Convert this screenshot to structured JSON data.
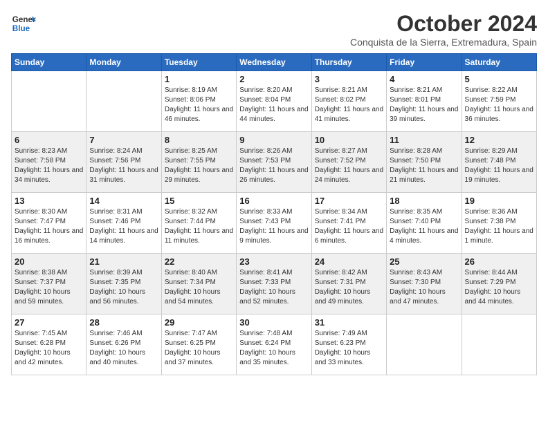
{
  "header": {
    "logo_general": "General",
    "logo_blue": "Blue",
    "month": "October 2024",
    "location": "Conquista de la Sierra, Extremadura, Spain"
  },
  "weekdays": [
    "Sunday",
    "Monday",
    "Tuesday",
    "Wednesday",
    "Thursday",
    "Friday",
    "Saturday"
  ],
  "weeks": [
    [
      {
        "day": "",
        "sunrise": "",
        "sunset": "",
        "daylight": ""
      },
      {
        "day": "",
        "sunrise": "",
        "sunset": "",
        "daylight": ""
      },
      {
        "day": "1",
        "sunrise": "Sunrise: 8:19 AM",
        "sunset": "Sunset: 8:06 PM",
        "daylight": "Daylight: 11 hours and 46 minutes."
      },
      {
        "day": "2",
        "sunrise": "Sunrise: 8:20 AM",
        "sunset": "Sunset: 8:04 PM",
        "daylight": "Daylight: 11 hours and 44 minutes."
      },
      {
        "day": "3",
        "sunrise": "Sunrise: 8:21 AM",
        "sunset": "Sunset: 8:02 PM",
        "daylight": "Daylight: 11 hours and 41 minutes."
      },
      {
        "day": "4",
        "sunrise": "Sunrise: 8:21 AM",
        "sunset": "Sunset: 8:01 PM",
        "daylight": "Daylight: 11 hours and 39 minutes."
      },
      {
        "day": "5",
        "sunrise": "Sunrise: 8:22 AM",
        "sunset": "Sunset: 7:59 PM",
        "daylight": "Daylight: 11 hours and 36 minutes."
      }
    ],
    [
      {
        "day": "6",
        "sunrise": "Sunrise: 8:23 AM",
        "sunset": "Sunset: 7:58 PM",
        "daylight": "Daylight: 11 hours and 34 minutes."
      },
      {
        "day": "7",
        "sunrise": "Sunrise: 8:24 AM",
        "sunset": "Sunset: 7:56 PM",
        "daylight": "Daylight: 11 hours and 31 minutes."
      },
      {
        "day": "8",
        "sunrise": "Sunrise: 8:25 AM",
        "sunset": "Sunset: 7:55 PM",
        "daylight": "Daylight: 11 hours and 29 minutes."
      },
      {
        "day": "9",
        "sunrise": "Sunrise: 8:26 AM",
        "sunset": "Sunset: 7:53 PM",
        "daylight": "Daylight: 11 hours and 26 minutes."
      },
      {
        "day": "10",
        "sunrise": "Sunrise: 8:27 AM",
        "sunset": "Sunset: 7:52 PM",
        "daylight": "Daylight: 11 hours and 24 minutes."
      },
      {
        "day": "11",
        "sunrise": "Sunrise: 8:28 AM",
        "sunset": "Sunset: 7:50 PM",
        "daylight": "Daylight: 11 hours and 21 minutes."
      },
      {
        "day": "12",
        "sunrise": "Sunrise: 8:29 AM",
        "sunset": "Sunset: 7:48 PM",
        "daylight": "Daylight: 11 hours and 19 minutes."
      }
    ],
    [
      {
        "day": "13",
        "sunrise": "Sunrise: 8:30 AM",
        "sunset": "Sunset: 7:47 PM",
        "daylight": "Daylight: 11 hours and 16 minutes."
      },
      {
        "day": "14",
        "sunrise": "Sunrise: 8:31 AM",
        "sunset": "Sunset: 7:46 PM",
        "daylight": "Daylight: 11 hours and 14 minutes."
      },
      {
        "day": "15",
        "sunrise": "Sunrise: 8:32 AM",
        "sunset": "Sunset: 7:44 PM",
        "daylight": "Daylight: 11 hours and 11 minutes."
      },
      {
        "day": "16",
        "sunrise": "Sunrise: 8:33 AM",
        "sunset": "Sunset: 7:43 PM",
        "daylight": "Daylight: 11 hours and 9 minutes."
      },
      {
        "day": "17",
        "sunrise": "Sunrise: 8:34 AM",
        "sunset": "Sunset: 7:41 PM",
        "daylight": "Daylight: 11 hours and 6 minutes."
      },
      {
        "day": "18",
        "sunrise": "Sunrise: 8:35 AM",
        "sunset": "Sunset: 7:40 PM",
        "daylight": "Daylight: 11 hours and 4 minutes."
      },
      {
        "day": "19",
        "sunrise": "Sunrise: 8:36 AM",
        "sunset": "Sunset: 7:38 PM",
        "daylight": "Daylight: 11 hours and 1 minute."
      }
    ],
    [
      {
        "day": "20",
        "sunrise": "Sunrise: 8:38 AM",
        "sunset": "Sunset: 7:37 PM",
        "daylight": "Daylight: 10 hours and 59 minutes."
      },
      {
        "day": "21",
        "sunrise": "Sunrise: 8:39 AM",
        "sunset": "Sunset: 7:35 PM",
        "daylight": "Daylight: 10 hours and 56 minutes."
      },
      {
        "day": "22",
        "sunrise": "Sunrise: 8:40 AM",
        "sunset": "Sunset: 7:34 PM",
        "daylight": "Daylight: 10 hours and 54 minutes."
      },
      {
        "day": "23",
        "sunrise": "Sunrise: 8:41 AM",
        "sunset": "Sunset: 7:33 PM",
        "daylight": "Daylight: 10 hours and 52 minutes."
      },
      {
        "day": "24",
        "sunrise": "Sunrise: 8:42 AM",
        "sunset": "Sunset: 7:31 PM",
        "daylight": "Daylight: 10 hours and 49 minutes."
      },
      {
        "day": "25",
        "sunrise": "Sunrise: 8:43 AM",
        "sunset": "Sunset: 7:30 PM",
        "daylight": "Daylight: 10 hours and 47 minutes."
      },
      {
        "day": "26",
        "sunrise": "Sunrise: 8:44 AM",
        "sunset": "Sunset: 7:29 PM",
        "daylight": "Daylight: 10 hours and 44 minutes."
      }
    ],
    [
      {
        "day": "27",
        "sunrise": "Sunrise: 7:45 AM",
        "sunset": "Sunset: 6:28 PM",
        "daylight": "Daylight: 10 hours and 42 minutes."
      },
      {
        "day": "28",
        "sunrise": "Sunrise: 7:46 AM",
        "sunset": "Sunset: 6:26 PM",
        "daylight": "Daylight: 10 hours and 40 minutes."
      },
      {
        "day": "29",
        "sunrise": "Sunrise: 7:47 AM",
        "sunset": "Sunset: 6:25 PM",
        "daylight": "Daylight: 10 hours and 37 minutes."
      },
      {
        "day": "30",
        "sunrise": "Sunrise: 7:48 AM",
        "sunset": "Sunset: 6:24 PM",
        "daylight": "Daylight: 10 hours and 35 minutes."
      },
      {
        "day": "31",
        "sunrise": "Sunrise: 7:49 AM",
        "sunset": "Sunset: 6:23 PM",
        "daylight": "Daylight: 10 hours and 33 minutes."
      },
      {
        "day": "",
        "sunrise": "",
        "sunset": "",
        "daylight": ""
      },
      {
        "day": "",
        "sunrise": "",
        "sunset": "",
        "daylight": ""
      }
    ]
  ]
}
